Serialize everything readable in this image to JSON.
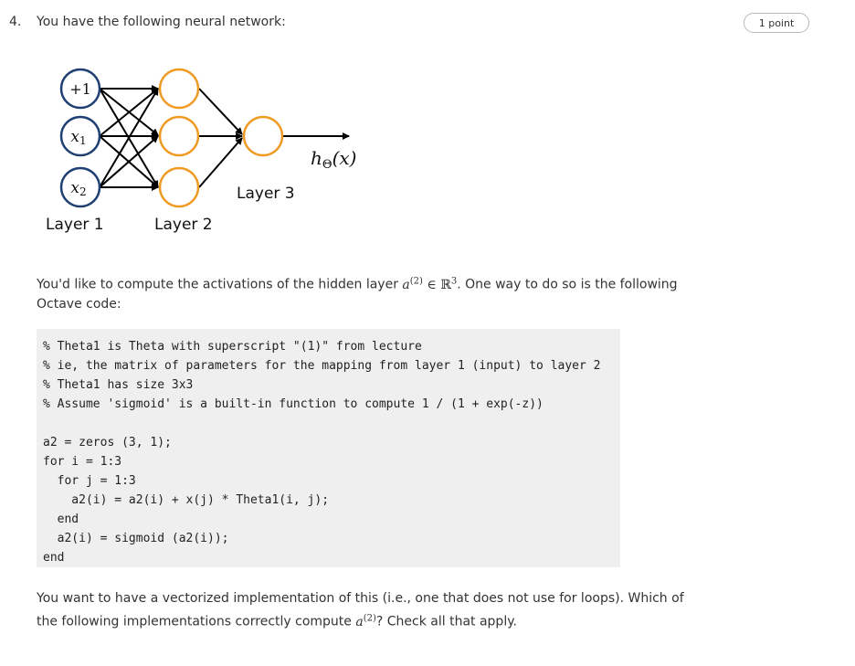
{
  "question": {
    "number": "4.",
    "title": "You have the following neural network:",
    "points_badge": "1 point"
  },
  "diagram": {
    "input_labels": [
      "+1",
      "x",
      "x"
    ],
    "input_subscripts": [
      "",
      "1",
      "2"
    ],
    "output_label_main": "h",
    "output_label_sub": "Θ",
    "output_label_arg": "(x)",
    "layer_labels": [
      "Layer 1",
      "Layer 2",
      "Layer 3"
    ],
    "colors": {
      "input_node": "#1f3f73",
      "hidden_node": "#ee9a23",
      "edge": "#000000"
    }
  },
  "paragraph1": {
    "before": "You'd like to compute the activations of the hidden layer ",
    "math_var": "a",
    "math_sup": "(2)",
    "math_rel": " ∈ ℝ",
    "math_rel_sup": "3",
    "after": ". One way to do so is the following Octave code:"
  },
  "code_lines": [
    "% Theta1 is Theta with superscript \"(1)\" from lecture",
    "% ie, the matrix of parameters for the mapping from layer 1 (input) to layer 2",
    "% Theta1 has size 3x3",
    "% Assume 'sigmoid' is a built-in function to compute 1 / (1 + exp(-z))",
    "",
    "a2 = zeros (3, 1);",
    "for i = 1:3",
    "  for j = 1:3",
    "    a2(i) = a2(i) + x(j) * Theta1(i, j);",
    "  end",
    "  a2(i) = sigmoid (a2(i));",
    "end"
  ],
  "paragraph2": {
    "before": "You want to have a vectorized implementation of this (i.e., one that does not use for loops). Which of the following implementations correctly compute ",
    "math_var": "a",
    "math_sup": "(2)",
    "after": "? Check all that apply."
  }
}
